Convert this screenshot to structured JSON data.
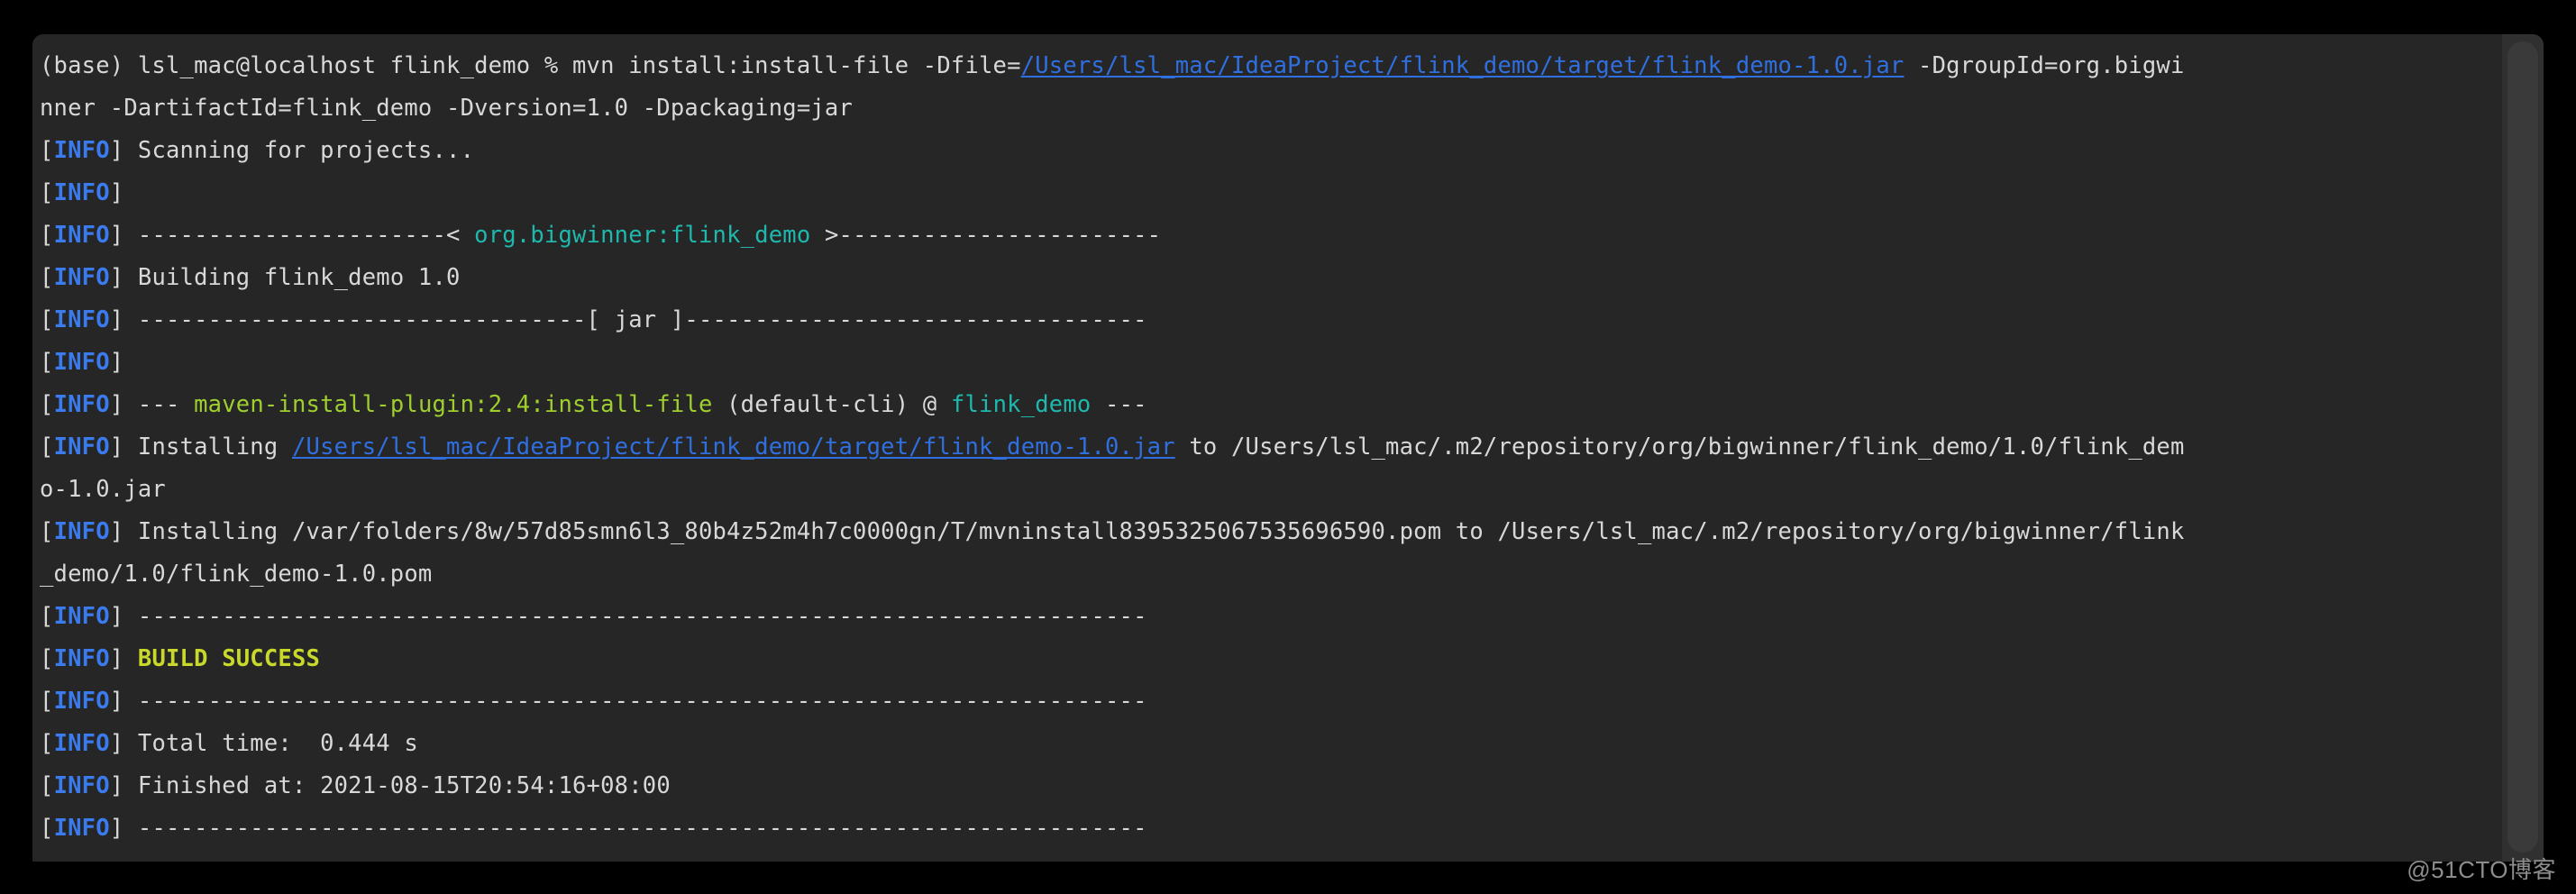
{
  "window": {
    "kind": "macos-terminal",
    "background": "#262626",
    "page_background": "#000000"
  },
  "colors": {
    "default_text": "#d8d8d8",
    "info_tag": "#3a7bf0",
    "link": "#2f6fe0",
    "artifact_cyan": "#1fb8ad",
    "plugin_green": "#9fcf2e",
    "build_success": "#c8d92b",
    "scrollbar_track": "#303030",
    "scrollbar_thumb": "#3a3a3a"
  },
  "watermark": {
    "text": "@51CTO博客"
  },
  "terminal": {
    "prompt": {
      "env": "(base)",
      "user_host": "lsl_mac@localhost",
      "cwd": "flink_demo",
      "symbol": "%"
    },
    "lines": [
      {
        "id": "prompt-line",
        "segments": [
          {
            "text": "(base) lsl_mac@localhost flink_demo % mvn install:install-file -Dfile=",
            "style": "white"
          },
          {
            "text": "/Users/lsl_mac/IdeaProject/flink_demo/target/flink_demo-1.0.jar",
            "style": "link"
          },
          {
            "text": " -DgroupId=org.bigwi",
            "style": "white"
          }
        ]
      },
      {
        "id": "prompt-line-wrap",
        "segments": [
          {
            "text": "nner -DartifactId=flink_demo -Dversion=1.0 -Dpackaging=jar",
            "style": "white"
          }
        ]
      },
      {
        "id": "scanning",
        "segments": [
          {
            "text": "[",
            "style": "white"
          },
          {
            "text": "INFO",
            "style": "info"
          },
          {
            "text": "] Scanning for projects...",
            "style": "white"
          }
        ]
      },
      {
        "id": "blank-1",
        "segments": [
          {
            "text": "[",
            "style": "white"
          },
          {
            "text": "INFO",
            "style": "info"
          },
          {
            "text": "] ",
            "style": "white"
          }
        ]
      },
      {
        "id": "project-banner",
        "segments": [
          {
            "text": "[",
            "style": "white"
          },
          {
            "text": "INFO",
            "style": "info"
          },
          {
            "text": "] ----------------------< ",
            "style": "white"
          },
          {
            "text": "org.bigwinner:flink_demo",
            "style": "cyan"
          },
          {
            "text": " >-----------------------",
            "style": "white"
          }
        ]
      },
      {
        "id": "building",
        "segments": [
          {
            "text": "[",
            "style": "white"
          },
          {
            "text": "INFO",
            "style": "info"
          },
          {
            "text": "] Building flink_demo 1.0",
            "style": "white"
          }
        ]
      },
      {
        "id": "packaging-banner",
        "segments": [
          {
            "text": "[",
            "style": "white"
          },
          {
            "text": "INFO",
            "style": "info"
          },
          {
            "text": "] --------------------------------[ jar ]---------------------------------",
            "style": "white"
          }
        ]
      },
      {
        "id": "blank-2",
        "segments": [
          {
            "text": "[",
            "style": "white"
          },
          {
            "text": "INFO",
            "style": "info"
          },
          {
            "text": "] ",
            "style": "white"
          }
        ]
      },
      {
        "id": "plugin-goal",
        "segments": [
          {
            "text": "[",
            "style": "white"
          },
          {
            "text": "INFO",
            "style": "info"
          },
          {
            "text": "] --- ",
            "style": "white"
          },
          {
            "text": "maven-install-plugin:2.4:install-file",
            "style": "green"
          },
          {
            "text": " (default-cli) @ ",
            "style": "white"
          },
          {
            "text": "flink_demo",
            "style": "cyan"
          },
          {
            "text": " ---",
            "style": "white"
          }
        ]
      },
      {
        "id": "installing-jar",
        "segments": [
          {
            "text": "[",
            "style": "white"
          },
          {
            "text": "INFO",
            "style": "info"
          },
          {
            "text": "] Installing ",
            "style": "white"
          },
          {
            "text": "/Users/lsl_mac/IdeaProject/flink_demo/target/flink_demo-1.0.jar",
            "style": "link"
          },
          {
            "text": " to /Users/lsl_mac/.m2/repository/org/bigwinner/flink_demo/1.0/flink_dem",
            "style": "white"
          }
        ]
      },
      {
        "id": "installing-jar-wrap",
        "segments": [
          {
            "text": "o-1.0.jar",
            "style": "white"
          }
        ]
      },
      {
        "id": "installing-pom",
        "segments": [
          {
            "text": "[",
            "style": "white"
          },
          {
            "text": "INFO",
            "style": "info"
          },
          {
            "text": "] Installing /var/folders/8w/57d85smn6l3_80b4z52m4h7c0000gn/T/mvninstall8395325067535696590.pom to /Users/lsl_mac/.m2/repository/org/bigwinner/flink",
            "style": "white"
          }
        ]
      },
      {
        "id": "installing-pom-wrap",
        "segments": [
          {
            "text": "_demo/1.0/flink_demo-1.0.pom",
            "style": "white"
          }
        ]
      },
      {
        "id": "rule-1",
        "segments": [
          {
            "text": "[",
            "style": "white"
          },
          {
            "text": "INFO",
            "style": "info"
          },
          {
            "text": "] ------------------------------------------------------------------------",
            "style": "white"
          }
        ]
      },
      {
        "id": "build-success",
        "segments": [
          {
            "text": "[",
            "style": "white"
          },
          {
            "text": "INFO",
            "style": "info"
          },
          {
            "text": "] ",
            "style": "white"
          },
          {
            "text": "BUILD SUCCESS",
            "style": "success"
          }
        ]
      },
      {
        "id": "rule-2",
        "segments": [
          {
            "text": "[",
            "style": "white"
          },
          {
            "text": "INFO",
            "style": "info"
          },
          {
            "text": "] ------------------------------------------------------------------------",
            "style": "white"
          }
        ]
      },
      {
        "id": "total-time",
        "segments": [
          {
            "text": "[",
            "style": "white"
          },
          {
            "text": "INFO",
            "style": "info"
          },
          {
            "text": "] Total time:  0.444 s",
            "style": "white"
          }
        ]
      },
      {
        "id": "finished-at",
        "segments": [
          {
            "text": "[",
            "style": "white"
          },
          {
            "text": "INFO",
            "style": "info"
          },
          {
            "text": "] Finished at: 2021-08-15T20:54:16+08:00",
            "style": "white"
          }
        ]
      },
      {
        "id": "rule-3",
        "segments": [
          {
            "text": "[",
            "style": "white"
          },
          {
            "text": "INFO",
            "style": "info"
          },
          {
            "text": "] ------------------------------------------------------------------------",
            "style": "white"
          }
        ]
      }
    ]
  }
}
